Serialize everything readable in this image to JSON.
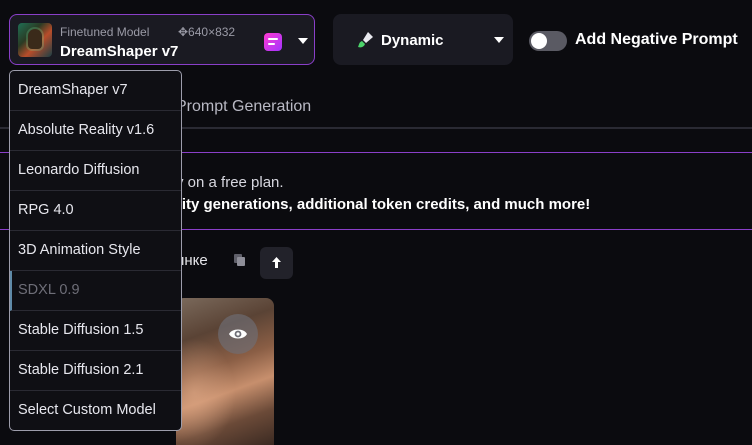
{
  "model_select": {
    "caption": "Finetuned Model",
    "dimensions": "✥640×832",
    "name": "DreamShaper v7"
  },
  "style_select": {
    "label": "Dynamic",
    "icon": "brush-icon"
  },
  "negative_prompt": {
    "label": "Add Negative Prompt",
    "enabled": false
  },
  "tab": {
    "label": "Prompt Generation"
  },
  "upsell": {
    "line1": "y on a free plan.",
    "line2": "rity generations, additional token credits, and much more!"
  },
  "image_label": "инке",
  "dropdown": {
    "items": [
      {
        "label": "DreamShaper v7",
        "disabled": false
      },
      {
        "label": "Absolute Reality v1.6",
        "disabled": false
      },
      {
        "label": "Leonardo Diffusion",
        "disabled": false
      },
      {
        "label": "RPG 4.0",
        "disabled": false
      },
      {
        "label": "3D Animation Style",
        "disabled": false
      },
      {
        "label": "SDXL 0.9",
        "disabled": true
      },
      {
        "label": "Stable Diffusion 1.5",
        "disabled": false
      },
      {
        "label": "Stable Diffusion 2.1",
        "disabled": false
      },
      {
        "label": "Select Custom Model",
        "disabled": false
      }
    ]
  },
  "colors": {
    "accent": "#8a3fc9",
    "background": "#0b0b0f",
    "panel": "#1a1a22"
  }
}
